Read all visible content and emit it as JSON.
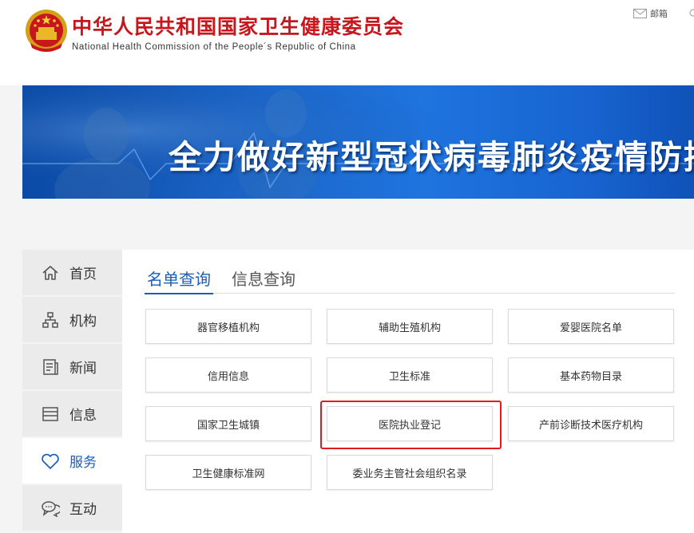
{
  "header": {
    "title_cn": "中华人民共和国国家卫生健康委员会",
    "title_en": "National Health Commission of the People´s Republic of China",
    "mail_label": "邮箱"
  },
  "banner": {
    "text": "全力做好新型冠状病毒肺炎疫情防控"
  },
  "sidebar": {
    "items": [
      {
        "label": "首页",
        "icon": "home-icon"
      },
      {
        "label": "机构",
        "icon": "org-chart-icon"
      },
      {
        "label": "新闻",
        "icon": "document-icon"
      },
      {
        "label": "信息",
        "icon": "list-icon"
      },
      {
        "label": "服务",
        "icon": "heart-icon",
        "active": true
      },
      {
        "label": "互动",
        "icon": "chat-icon"
      }
    ]
  },
  "tabs": [
    {
      "label": "名单查询",
      "active": true
    },
    {
      "label": "信息查询",
      "active": false
    }
  ],
  "services": [
    [
      "器官移植机构",
      "辅助生殖机构",
      "爱婴医院名单"
    ],
    [
      "信用信息",
      "卫生标准",
      "基本药物目录"
    ],
    [
      "国家卫生城镇",
      "医院执业登记",
      "产前诊断技术医疗机构"
    ],
    [
      "卫生健康标准网",
      "委业务主管社会组织名录"
    ]
  ],
  "colors": {
    "brand_red": "#c8161d",
    "accent_blue": "#1a5eb8",
    "highlight_red": "#e31b1b"
  }
}
